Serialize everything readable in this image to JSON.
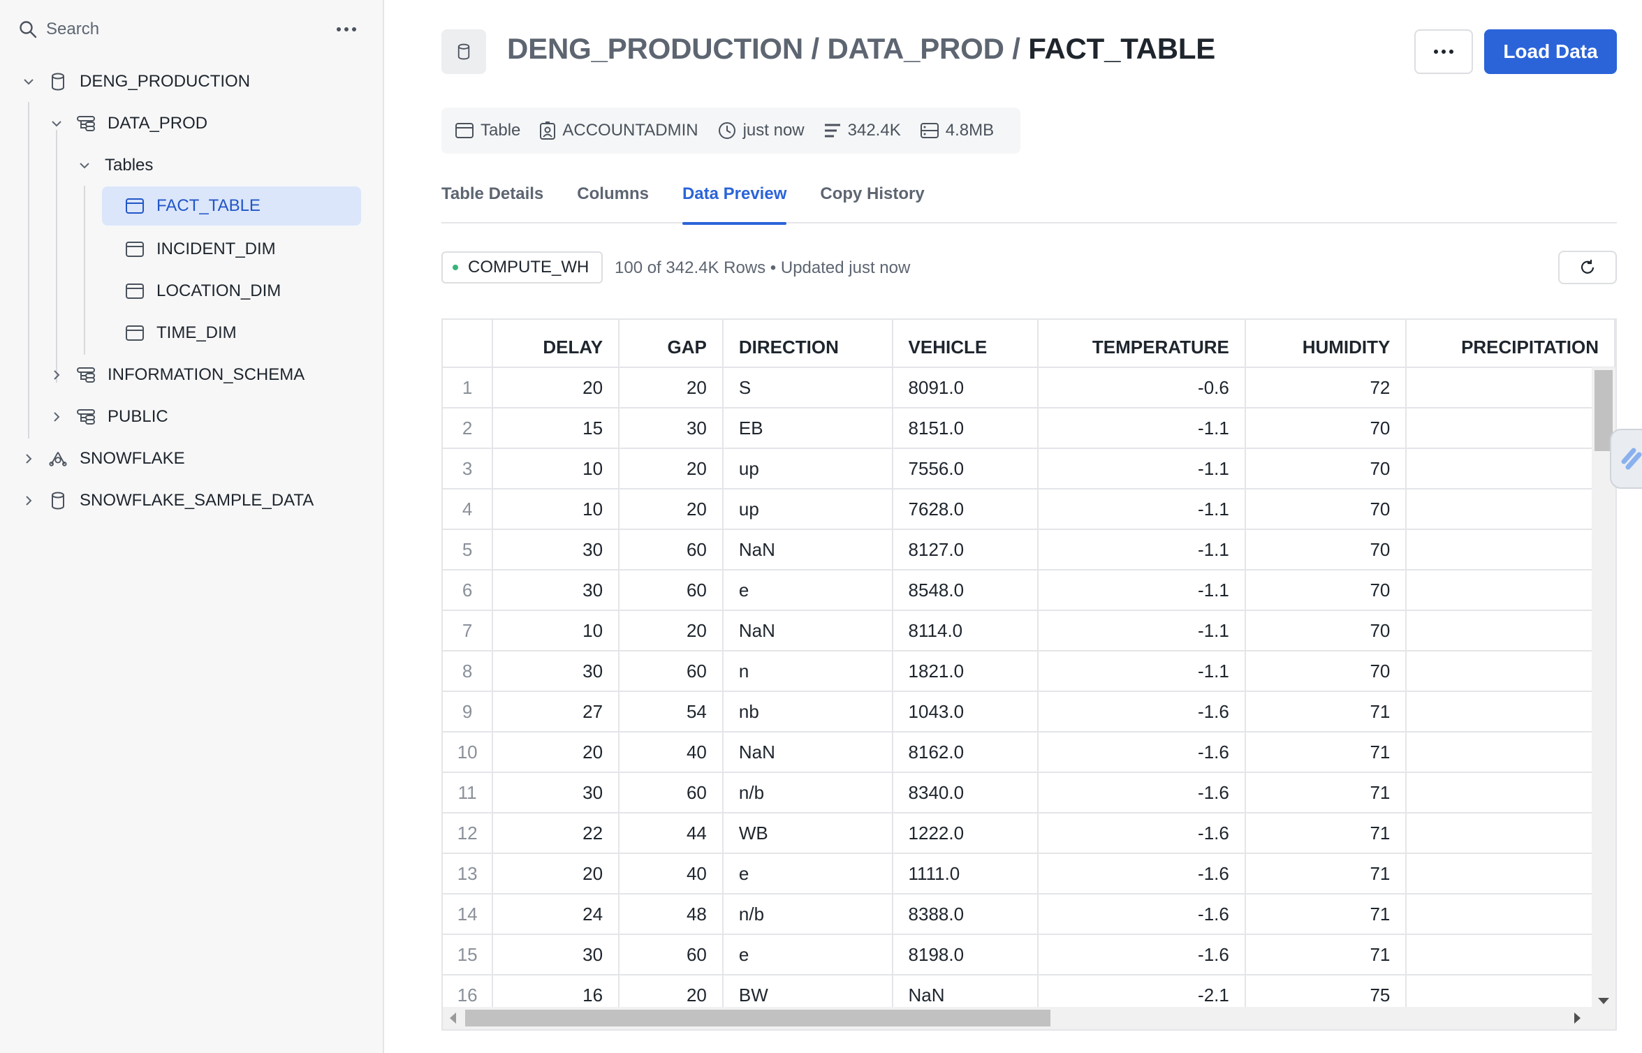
{
  "sidebar": {
    "search_placeholder": "Search",
    "tree": [
      {
        "label": "DENG_PRODUCTION",
        "icon": "database-icon",
        "expanded": true
      },
      {
        "label": "DATA_PROD",
        "icon": "schema-icon",
        "expanded": true
      },
      {
        "label": "Tables",
        "expanded": true
      },
      {
        "label": "FACT_TABLE",
        "icon": "table-icon",
        "selected": true
      },
      {
        "label": "INCIDENT_DIM",
        "icon": "table-icon"
      },
      {
        "label": "LOCATION_DIM",
        "icon": "table-icon"
      },
      {
        "label": "TIME_DIM",
        "icon": "table-icon"
      },
      {
        "label": "INFORMATION_SCHEMA",
        "icon": "schema-icon",
        "expanded": false
      },
      {
        "label": "PUBLIC",
        "icon": "schema-icon",
        "expanded": false
      },
      {
        "label": "SNOWFLAKE",
        "icon": "snowflake-share-icon",
        "expanded": false
      },
      {
        "label": "SNOWFLAKE_SAMPLE_DATA",
        "icon": "database-icon",
        "expanded": false
      }
    ]
  },
  "header": {
    "path_db": "DENG_PRODUCTION",
    "sep1": " / ",
    "path_schema": "DATA_PROD",
    "sep2": " / ",
    "path_table": "FACT_TABLE",
    "load_label": "Load Data"
  },
  "meta": {
    "type": "Table",
    "owner": "ACCOUNTADMIN",
    "updated": "just now",
    "rows": "342.4K",
    "size": "4.8MB"
  },
  "tabs": [
    "Table Details",
    "Columns",
    "Data Preview",
    "Copy History"
  ],
  "active_tab": "Data Preview",
  "toolbar": {
    "warehouse": "COMPUTE_WH",
    "rows_info": "100 of 342.4K Rows • Updated just now"
  },
  "accent_color": "#2b64d9",
  "table": {
    "columns": [
      "",
      "DELAY",
      "GAP",
      "DIRECTION",
      "VEHICLE",
      "TEMPERATURE",
      "HUMIDITY",
      "PRECIPITATION"
    ],
    "rows": [
      [
        "1",
        "20",
        "20",
        "S",
        "8091.0",
        "-0.6",
        "72",
        ""
      ],
      [
        "2",
        "15",
        "30",
        "EB",
        "8151.0",
        "-1.1",
        "70",
        ""
      ],
      [
        "3",
        "10",
        "20",
        "up",
        "7556.0",
        "-1.1",
        "70",
        ""
      ],
      [
        "4",
        "10",
        "20",
        "up",
        "7628.0",
        "-1.1",
        "70",
        ""
      ],
      [
        "5",
        "30",
        "60",
        "NaN",
        "8127.0",
        "-1.1",
        "70",
        ""
      ],
      [
        "6",
        "30",
        "60",
        "e",
        "8548.0",
        "-1.1",
        "70",
        ""
      ],
      [
        "7",
        "10",
        "20",
        "NaN",
        "8114.0",
        "-1.1",
        "70",
        ""
      ],
      [
        "8",
        "30",
        "60",
        "n",
        "1821.0",
        "-1.1",
        "70",
        ""
      ],
      [
        "9",
        "27",
        "54",
        "nb",
        "1043.0",
        "-1.6",
        "71",
        ""
      ],
      [
        "10",
        "20",
        "40",
        "NaN",
        "8162.0",
        "-1.6",
        "71",
        ""
      ],
      [
        "11",
        "30",
        "60",
        "n/b",
        "8340.0",
        "-1.6",
        "71",
        ""
      ],
      [
        "12",
        "22",
        "44",
        "WB",
        "1222.0",
        "-1.6",
        "71",
        ""
      ],
      [
        "13",
        "20",
        "40",
        "e",
        "1111.0",
        "-1.6",
        "71",
        ""
      ],
      [
        "14",
        "24",
        "48",
        "n/b",
        "8388.0",
        "-1.6",
        "71",
        ""
      ],
      [
        "15",
        "30",
        "60",
        "e",
        "8198.0",
        "-1.6",
        "71",
        ""
      ],
      [
        "16",
        "16",
        "20",
        "BW",
        "NaN",
        "-2.1",
        "75",
        ""
      ]
    ]
  }
}
